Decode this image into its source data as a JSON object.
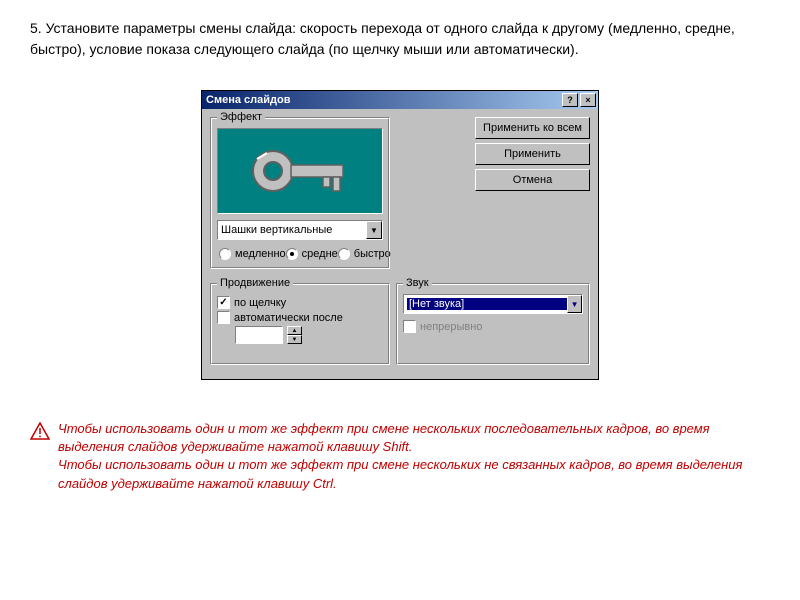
{
  "instruction": {
    "text": "5.  Установите параметры смены слайда: скорость перехода от одного слайда к другому (медленно, средне, быстро), условие показа следующего слайда (по щелчку мыши или автоматически)."
  },
  "dialog": {
    "title": "Смена слайдов",
    "effect_group": "Эффект",
    "effect_dropdown": "Шашки вертикальные",
    "speed": {
      "slow": "медленно",
      "medium": "средне",
      "fast": "быстро",
      "selected": "medium"
    },
    "advance_group": "Продвижение",
    "advance": {
      "on_click": "по щелчку",
      "auto_after": "автоматически после",
      "on_click_checked": true,
      "auto_checked": false,
      "time_value": ""
    },
    "sound_group": "Звук",
    "sound": {
      "selected": "[Нет звука]",
      "loop": "непрерывно",
      "loop_checked": false
    },
    "buttons": {
      "apply_all": "Применить ко всем",
      "apply": "Применить",
      "cancel": "Отмена"
    }
  },
  "warning": {
    "line1": "    Чтобы использовать один и тот же эффект при смене нескольких последовательных кадров, во время выделения слайдов удерживайте нажатой клавишу Shift.",
    "line2": "     Чтобы использовать один и тот же эффект при смене нескольких не связанных кадров, во время выделения слайдов удерживайте нажатой клавишу Ctrl."
  }
}
